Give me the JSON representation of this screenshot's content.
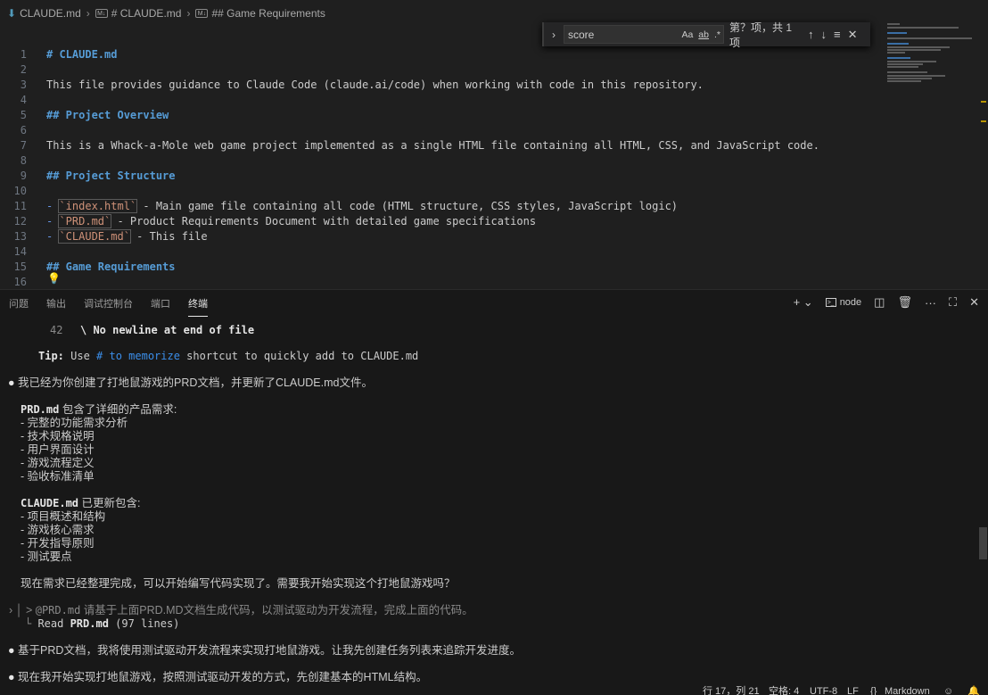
{
  "breadcrumb": {
    "file": "CLAUDE.md",
    "section1": "# CLAUDE.md",
    "section2": "## Game Requirements"
  },
  "find": {
    "value": "score",
    "match_case": "Aa",
    "whole_word": "ab",
    "regex": ".*",
    "count": "第？项，共 1 项"
  },
  "editor": {
    "lines": [
      {
        "n": "1",
        "text": "# CLAUDE.md"
      },
      {
        "n": "2",
        "text": ""
      },
      {
        "n": "3",
        "text": "This file provides guidance to Claude Code (claude.ai/code) when working with code in this repository."
      },
      {
        "n": "4",
        "text": ""
      },
      {
        "n": "5",
        "text": "## Project Overview"
      },
      {
        "n": "6",
        "text": ""
      },
      {
        "n": "7",
        "text": "This is a Whack-a-Mole web game project implemented as a single HTML file containing all HTML, CSS, and JavaScript code."
      },
      {
        "n": "8",
        "text": ""
      },
      {
        "n": "9",
        "text": "## Project Structure"
      },
      {
        "n": "10",
        "text": ""
      },
      {
        "n": "11",
        "code": "`index.html`",
        "text": " - Main game file containing all code (HTML structure, CSS styles, JavaScript logic)"
      },
      {
        "n": "12",
        "code": "`PRD.md`",
        "text": " - Product Requirements Document with detailed game specifications"
      },
      {
        "n": "13",
        "code": "`CLAUDE.md`",
        "text": " - This file"
      },
      {
        "n": "14",
        "text": ""
      },
      {
        "n": "15",
        "text": "## Game Requirements"
      },
      {
        "n": "16",
        "text": ""
      }
    ]
  },
  "panel": {
    "tabs": [
      "问题",
      "输出",
      "调试控制台",
      "端口",
      "终端"
    ],
    "terminal_name": "node"
  },
  "terminal": {
    "l_num": "42",
    "l_nonl": "\\ No newline at end of file",
    "tip_a": "Tip:",
    "tip_b": " Use ",
    "tip_c": "# to memorize",
    "tip_d": " shortcut to quickly add to CLAUDE.md",
    "msg1": "我已经为你创建了打地鼠游戏的PRD文档，并更新了CLAUDE.md文件。",
    "prd_title": "PRD.md",
    "prd_rest": " 包含了详细的产品需求:",
    "prd_items": [
      "- 完整的功能需求分析",
      "- 技术规格说明",
      "- 用户界面设计",
      "- 游戏流程定义",
      "- 验收标准清单"
    ],
    "claude_title": "CLAUDE.md",
    "claude_rest": " 已更新包含:",
    "claude_items": [
      "- 项目概述和结构",
      "- 游戏核心需求",
      "- 开发指导原则",
      "- 测试要点"
    ],
    "msg2": "现在需求已经整理完成，可以开始编写代码实现了。需要我开始实现这个打地鼠游戏吗？",
    "prompt_a": "> ",
    "prompt_b": "@PRD.md",
    "prompt_c": " 请基于上面PRD.MD文档生成代码，以测试驱动为开发流程，完成上面的代码。",
    "read_a": "Read ",
    "read_b": "PRD.md",
    "read_c": " (97 lines)",
    "msg3": "基于PRD文档，我将使用测试驱动开发流程来实现打地鼠游戏。让我先创建任务列表来追踪开发进度。",
    "msg4": "现在我开始实现打地鼠游戏，按照测试驱动开发的方式，先创建基本的HTML结构。"
  },
  "status": {
    "position": "行 17，列 21",
    "spaces": "空格: 4",
    "encoding": "UTF-8",
    "eol": "LF",
    "language": "Markdown"
  }
}
